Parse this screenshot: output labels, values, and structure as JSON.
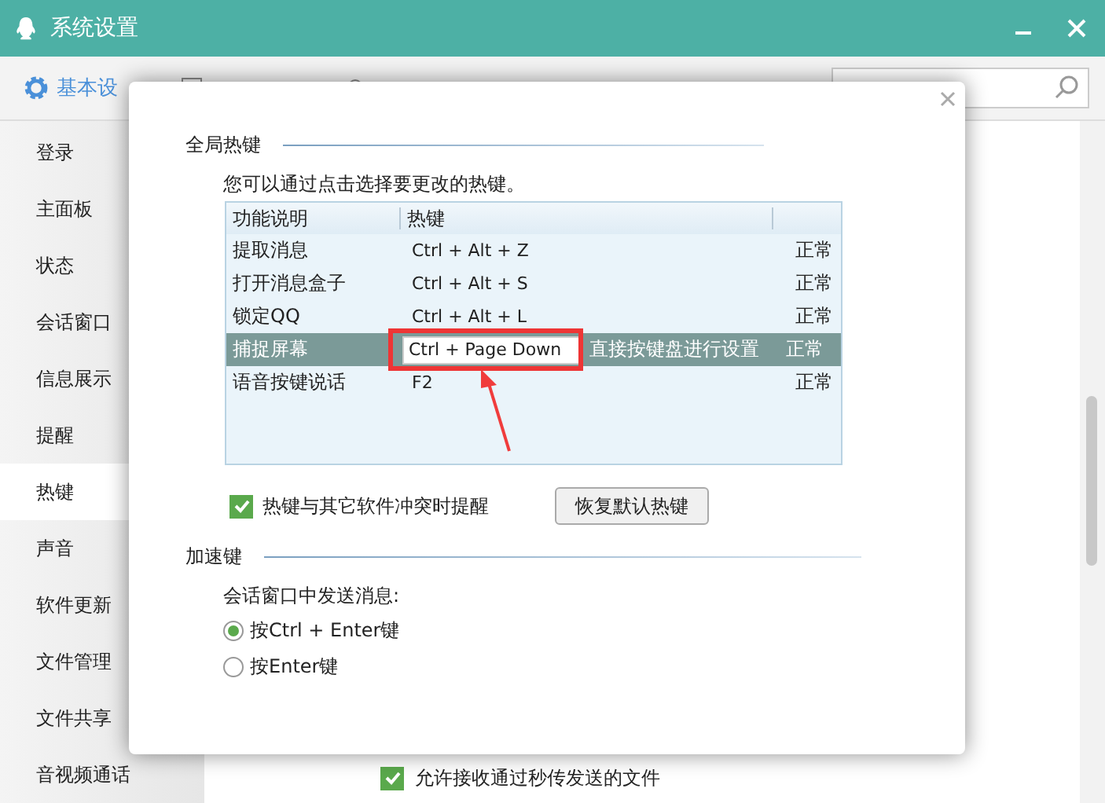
{
  "window": {
    "title": "系统设置"
  },
  "tabs": [
    {
      "label": "基本设",
      "selected": true
    }
  ],
  "sidebar": {
    "items": [
      {
        "label": "登录",
        "selected": false
      },
      {
        "label": "主面板",
        "selected": false
      },
      {
        "label": "状态",
        "selected": false
      },
      {
        "label": "会话窗口",
        "selected": false
      },
      {
        "label": "信息展示",
        "selected": false
      },
      {
        "label": "提醒",
        "selected": false
      },
      {
        "label": "热键",
        "selected": true
      },
      {
        "label": "声音",
        "selected": false
      },
      {
        "label": "软件更新",
        "selected": false
      },
      {
        "label": "文件管理",
        "selected": false
      },
      {
        "label": "文件共享",
        "selected": false
      },
      {
        "label": "音视频通话",
        "selected": false
      }
    ]
  },
  "background_option": {
    "label": "允许接收通过秒传发送的文件",
    "checked": true
  },
  "dialog": {
    "section_title": "全局热键",
    "hint": "您可以通过点击选择要更改的热键。",
    "table": {
      "columns": [
        "功能说明",
        "热键"
      ],
      "rows": [
        {
          "function": "提取消息",
          "hotkey": "Ctrl + Alt + Z",
          "status": "正常",
          "selected": false
        },
        {
          "function": "打开消息盒子",
          "hotkey": "Ctrl + Alt + S",
          "status": "正常",
          "selected": false
        },
        {
          "function": "锁定QQ",
          "hotkey": "Ctrl + Alt + L",
          "status": "正常",
          "selected": false
        },
        {
          "function": "捕捉屏幕",
          "hotkey": "Ctrl + Page Down",
          "edit_hint": "直接按键盘进行设置",
          "status": "正常",
          "selected": true
        },
        {
          "function": "语音按键说话",
          "hotkey": "F2",
          "status": "正常",
          "selected": false
        }
      ]
    },
    "conflict_alert": {
      "label": "热键与其它软件冲突时提醒",
      "checked": true
    },
    "restore_button": "恢复默认热键",
    "accel_section": {
      "title": "加速键",
      "prompt": "会话窗口中发送消息:",
      "options": [
        {
          "label": "按Ctrl + Enter键",
          "selected": true
        },
        {
          "label": "按Enter键",
          "selected": false
        }
      ]
    }
  }
}
